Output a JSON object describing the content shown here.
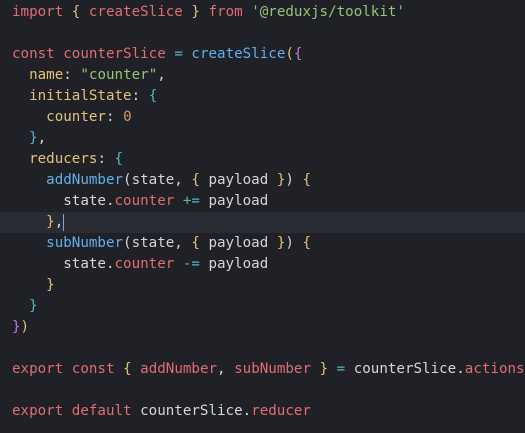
{
  "editor": {
    "lines": [
      {
        "tokens": [
          [
            "kw",
            "import"
          ],
          [
            "plain",
            " "
          ],
          [
            "brace1",
            "{"
          ],
          [
            "plain",
            " "
          ],
          [
            "kw",
            "createSlice"
          ],
          [
            "plain",
            " "
          ],
          [
            "brace1",
            "}"
          ],
          [
            "plain",
            " "
          ],
          [
            "kw",
            "from"
          ],
          [
            "plain",
            " "
          ],
          [
            "str",
            "'@reduxjs/toolkit'"
          ]
        ]
      },
      {
        "tokens": []
      },
      {
        "tokens": [
          [
            "kw",
            "const"
          ],
          [
            "plain",
            " "
          ],
          [
            "kw",
            "counterSlice"
          ],
          [
            "plain",
            " "
          ],
          [
            "op",
            "="
          ],
          [
            "plain",
            " "
          ],
          [
            "fn",
            "createSlice"
          ],
          [
            "brace1",
            "("
          ],
          [
            "brace2",
            "{"
          ]
        ]
      },
      {
        "tokens": [
          [
            "dot",
            "  "
          ],
          [
            "prop",
            "name"
          ],
          [
            "plain",
            ": "
          ],
          [
            "str",
            "\"counter\""
          ],
          [
            "plain",
            ","
          ]
        ]
      },
      {
        "tokens": [
          [
            "dot",
            "  "
          ],
          [
            "prop",
            "initialState"
          ],
          [
            "plain",
            ": "
          ],
          [
            "brace3",
            "{"
          ]
        ]
      },
      {
        "tokens": [
          [
            "dot",
            "    "
          ],
          [
            "prop",
            "counter"
          ],
          [
            "plain",
            ": "
          ],
          [
            "num",
            "0"
          ]
        ]
      },
      {
        "tokens": [
          [
            "dot",
            "  "
          ],
          [
            "brace3",
            "}"
          ],
          [
            "plain",
            ","
          ]
        ]
      },
      {
        "tokens": [
          [
            "dot",
            "  "
          ],
          [
            "prop",
            "reducers"
          ],
          [
            "plain",
            ": "
          ],
          [
            "brace3",
            "{"
          ]
        ]
      },
      {
        "tokens": [
          [
            "dot",
            "    "
          ],
          [
            "fn",
            "addNumber"
          ],
          [
            "plain",
            "(state, "
          ],
          [
            "brace1",
            "{"
          ],
          [
            "plain",
            " payload "
          ],
          [
            "brace1",
            "}"
          ],
          [
            "plain",
            ") "
          ],
          [
            "brace1",
            "{"
          ]
        ]
      },
      {
        "tokens": [
          [
            "dot",
            "      "
          ],
          [
            "plain",
            "state."
          ],
          [
            "kw",
            "counter"
          ],
          [
            "plain",
            " "
          ],
          [
            "op",
            "+="
          ],
          [
            "plain",
            " payload"
          ]
        ]
      },
      {
        "tokens": [
          [
            "dot",
            "    "
          ],
          [
            "brace1",
            "}"
          ],
          [
            "plain",
            ","
          ]
        ],
        "current": true
      },
      {
        "tokens": [
          [
            "dot",
            "    "
          ],
          [
            "fn",
            "subNumber"
          ],
          [
            "plain",
            "(state, "
          ],
          [
            "brace1",
            "{"
          ],
          [
            "plain",
            " payload "
          ],
          [
            "brace1",
            "}"
          ],
          [
            "plain",
            ") "
          ],
          [
            "brace1",
            "{"
          ]
        ]
      },
      {
        "tokens": [
          [
            "dot",
            "      "
          ],
          [
            "plain",
            "state."
          ],
          [
            "kw",
            "counter"
          ],
          [
            "plain",
            " "
          ],
          [
            "op",
            "-="
          ],
          [
            "plain",
            " payload"
          ]
        ]
      },
      {
        "tokens": [
          [
            "dot",
            "    "
          ],
          [
            "brace1",
            "}"
          ]
        ]
      },
      {
        "tokens": [
          [
            "dot",
            "  "
          ],
          [
            "brace3",
            "}"
          ]
        ]
      },
      {
        "tokens": [
          [
            "brace2",
            "}"
          ],
          [
            "brace1",
            ")"
          ]
        ]
      },
      {
        "tokens": []
      },
      {
        "tokens": [
          [
            "kw",
            "export"
          ],
          [
            "plain",
            " "
          ],
          [
            "kw",
            "const"
          ],
          [
            "plain",
            " "
          ],
          [
            "brace1",
            "{"
          ],
          [
            "plain",
            " "
          ],
          [
            "kw",
            "addNumber"
          ],
          [
            "plain",
            ", "
          ],
          [
            "kw",
            "subNumber"
          ],
          [
            "plain",
            " "
          ],
          [
            "brace1",
            "}"
          ],
          [
            "plain",
            " "
          ],
          [
            "op",
            "="
          ],
          [
            "plain",
            " counterSlice."
          ],
          [
            "kw",
            "actions"
          ]
        ]
      },
      {
        "tokens": []
      },
      {
        "tokens": [
          [
            "kw",
            "export"
          ],
          [
            "plain",
            " "
          ],
          [
            "kw",
            "default"
          ],
          [
            "plain",
            " counterSlice."
          ],
          [
            "kw",
            "reducer"
          ]
        ]
      }
    ]
  }
}
